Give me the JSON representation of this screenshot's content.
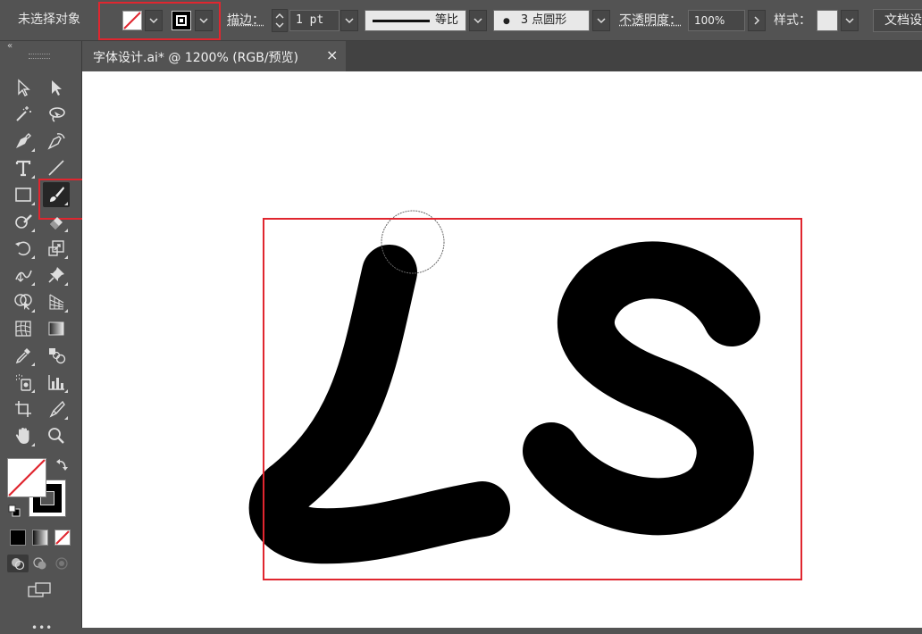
{
  "control_bar": {
    "selection_status": "未选择对象",
    "stroke_label": "描边：",
    "stroke_weight": "1 pt",
    "stroke_profile": "等比",
    "brush_definition": "3 点圆形",
    "opacity_label": "不透明度：",
    "opacity_value": "100%",
    "style_label": "样式：",
    "document_setup": "文档设"
  },
  "document_tab": {
    "title": "字体设计.ai* @ 1200% (RGB/预览)",
    "close_glyph": "×"
  },
  "toolbar": {
    "tools": [
      "selection-tool",
      "direct-selection-tool",
      "magic-wand-tool",
      "lasso-tool",
      "pen-tool",
      "curvature-tool",
      "type-tool",
      "line-segment-tool",
      "rectangle-tool",
      "paintbrush-tool",
      "shaper-tool",
      "eraser-tool",
      "rotate-tool",
      "scale-tool",
      "width-tool",
      "puppet-warp-tool",
      "shape-builder-tool",
      "perspective-grid-tool",
      "mesh-tool",
      "gradient-tool",
      "eyedropper-tool",
      "blend-tool",
      "symbol-sprayer-tool",
      "column-graph-tool",
      "artboard-tool",
      "slice-tool",
      "hand-tool",
      "zoom-tool"
    ],
    "active_tool": "paintbrush-tool"
  },
  "colors": {
    "ui_bg": "#535353",
    "highlight": "#e0262f",
    "artwork": "#000000",
    "canvas": "#ffffff"
  }
}
